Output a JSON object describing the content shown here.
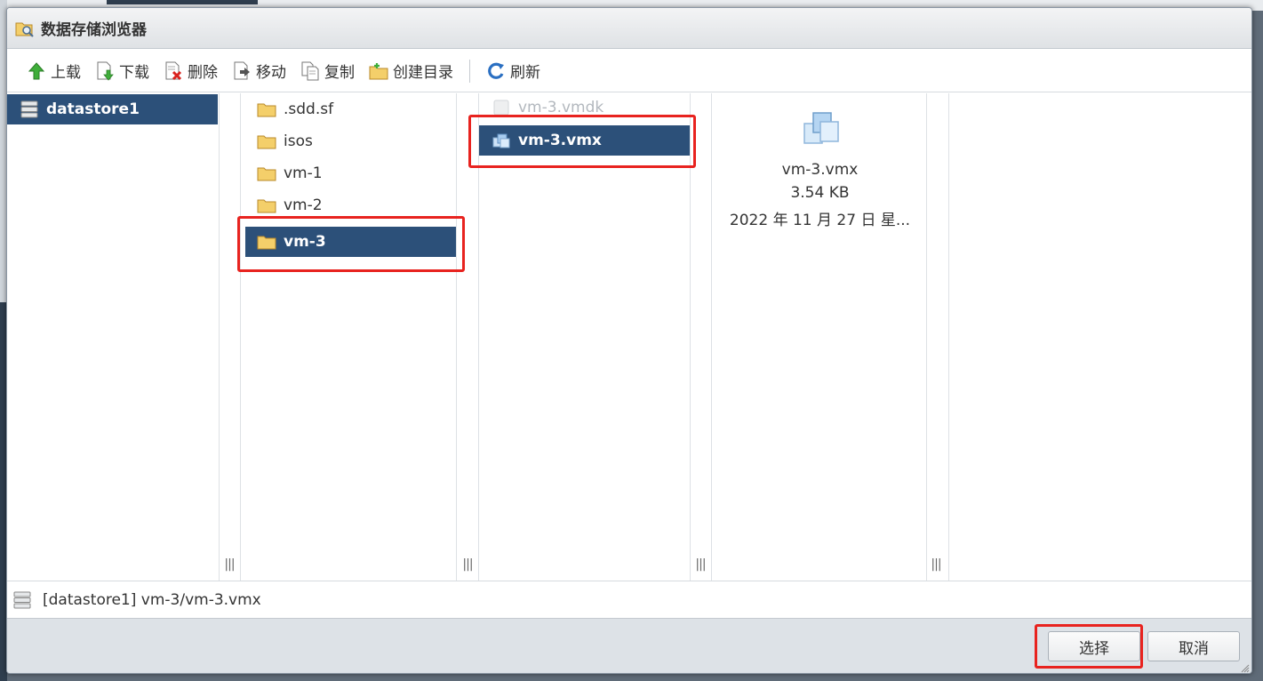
{
  "window": {
    "title": "数据存储浏览器"
  },
  "toolbar": {
    "upload": "上载",
    "download": "下载",
    "delete": "删除",
    "move": "移动",
    "copy": "复制",
    "mkdir": "创建目录",
    "refresh": "刷新"
  },
  "columns": {
    "datastores": [
      {
        "label": "datastore1",
        "selected": true
      }
    ],
    "folders": [
      {
        "label": ".sdd.sf"
      },
      {
        "label": "isos"
      },
      {
        "label": "vm-1"
      },
      {
        "label": "vm-2"
      },
      {
        "label": "vm-3",
        "selected": true
      }
    ],
    "files": [
      {
        "label": "vm-3.vmdk",
        "disabled": true
      },
      {
        "label": "vm-3.vmx",
        "selected": true
      }
    ]
  },
  "preview": {
    "name": "vm-3.vmx",
    "size": "3.54 KB",
    "date": "2022 年 11 月 27 日 星..."
  },
  "path": {
    "text": "[datastore1] vm-3/vm-3.vmx"
  },
  "footer": {
    "select": "选择",
    "cancel": "取消"
  },
  "colors": {
    "selection": "#2c5079",
    "highlight_box": "#e8231f"
  }
}
